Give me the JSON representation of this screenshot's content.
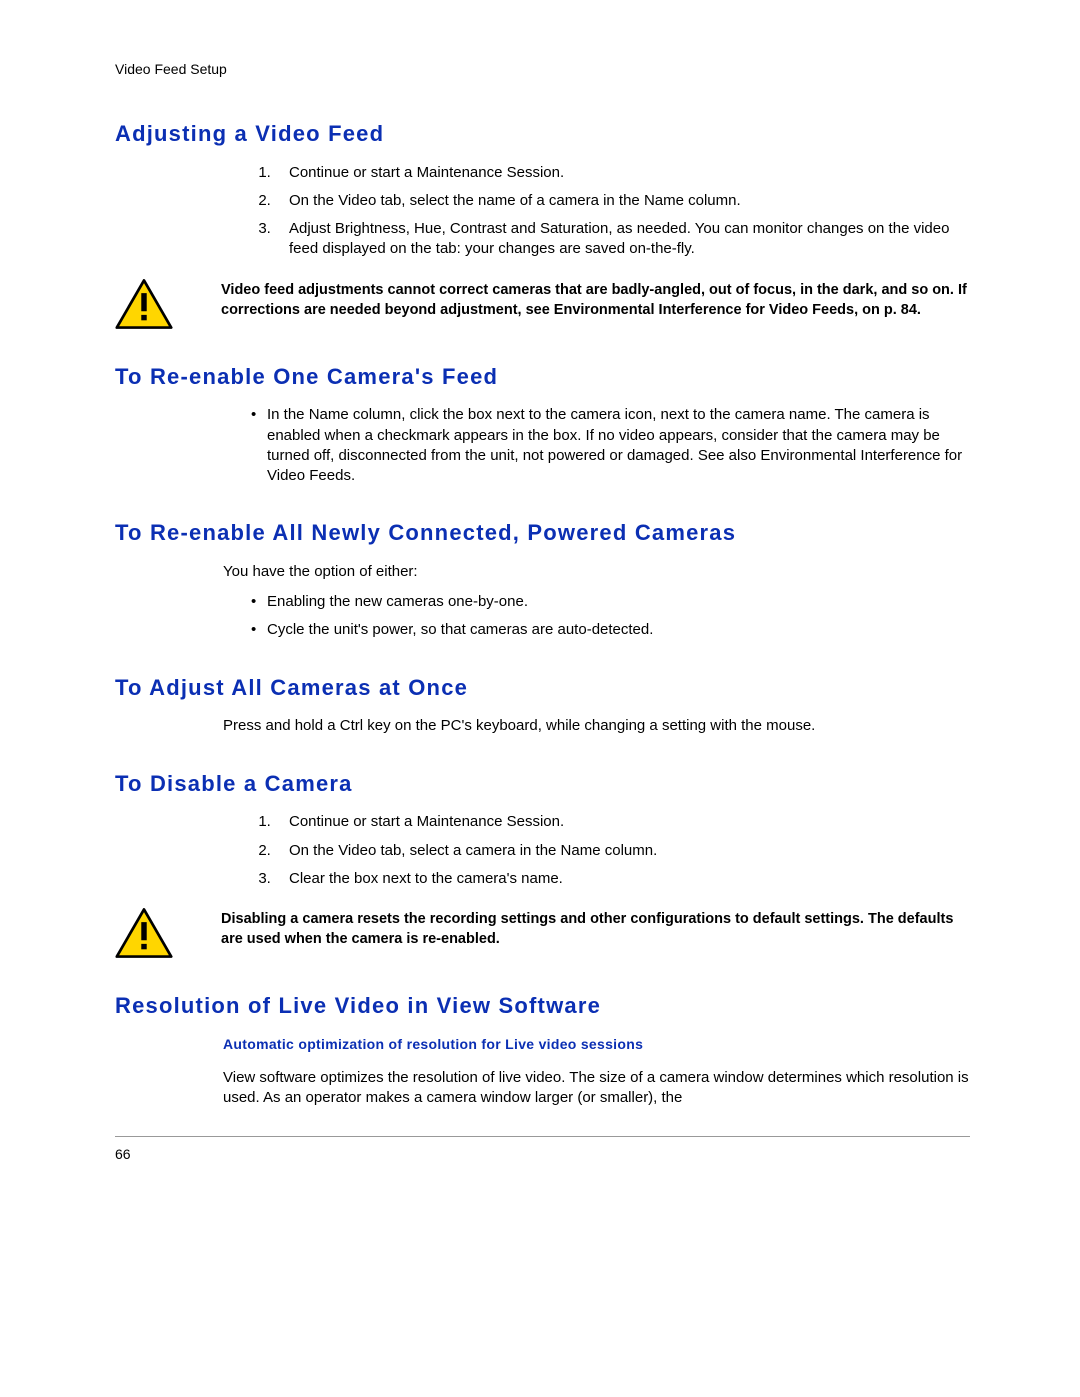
{
  "header": "Video Feed Setup",
  "sections": {
    "adjusting": {
      "title": "Adjusting a Video Feed",
      "steps": [
        "Continue or start a Maintenance Session.",
        "On the Video tab, select the name of a camera in the Name column.",
        "Adjust Brightness, Hue, Contrast and Saturation, as needed. You can monitor changes on the video feed displayed on the tab: your changes are saved on-the-fly."
      ],
      "warning": "Video feed adjustments cannot correct cameras that are badly-angled, out of focus, in the dark, and so on. If corrections are needed beyond adjustment, see Environmental Interference for Video Feeds, on p. 84."
    },
    "reenable_one": {
      "title": "To Re-enable One Camera's Feed",
      "bullets": [
        "In the Name column, click the box next to the camera icon, next to the camera name. The camera is enabled when a checkmark appears in the box. If no video appears, consider that the camera may be turned off, disconnected from the unit, not powered or damaged. See also Environmental Interference for Video Feeds."
      ]
    },
    "reenable_all": {
      "title": "To Re-enable All Newly Connected, Powered Cameras",
      "intro": "You have the option of either:",
      "bullets": [
        "Enabling the new cameras one-by-one.",
        "Cycle the unit's power, so that cameras are auto-detected."
      ]
    },
    "adjust_all": {
      "title": "To Adjust All Cameras at Once",
      "paragraph": "Press and hold a Ctrl key on the PC's keyboard,  while changing a setting with the mouse."
    },
    "disable": {
      "title": "To Disable a Camera",
      "steps": [
        "Continue or start a Maintenance Session.",
        "On the Video tab, select a camera in the Name column.",
        "Clear the box next to the camera's name."
      ],
      "warning": "Disabling a camera resets the recording settings and other configurations to default settings. The defaults are used when the camera is re-enabled."
    },
    "resolution": {
      "title": "Resolution of Live Video in View Software",
      "subheading": "Automatic optimization of resolution for Live video sessions",
      "paragraph": "View software  optimizes the resolution of live video. The size of a camera window determines which resolution is used. As an operator makes a camera window larger (or smaller), the"
    }
  },
  "page_number": "66"
}
